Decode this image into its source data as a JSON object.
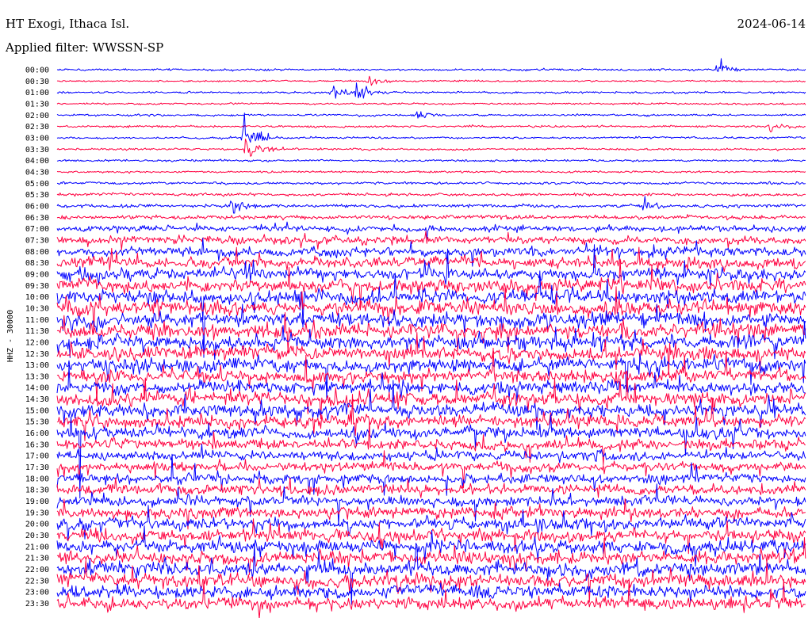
{
  "header": {
    "station": "HT Exogi, Ithaca Isl.",
    "date": "2024-06-14",
    "filter": "Applied filter: WWSSN-SP"
  },
  "chart_data": {
    "type": "line",
    "title": "HT Exogi, Ithaca Isl.",
    "date": "2024-06-14",
    "filter": "WWSSN-SP",
    "ylabel": "HHZ - 30000",
    "row_labels": [
      "00:00",
      "00:30",
      "01:00",
      "01:30",
      "02:00",
      "02:30",
      "03:00",
      "03:30",
      "04:00",
      "04:30",
      "05:00",
      "05:30",
      "06:00",
      "06:30",
      "07:00",
      "07:30",
      "08:00",
      "08:30",
      "09:00",
      "09:30",
      "10:00",
      "10:30",
      "11:00",
      "11:30",
      "12:00",
      "12:30",
      "13:00",
      "13:30",
      "14:00",
      "14:30",
      "15:00",
      "15:30",
      "16:00",
      "16:30",
      "17:00",
      "17:30",
      "18:00",
      "18:30",
      "19:00",
      "19:30",
      "20:00",
      "20:30",
      "21:00",
      "21:30",
      "22:00",
      "22:30",
      "23:00",
      "23:30"
    ],
    "row_minutes": 30,
    "trace_colors": [
      "#0000ff",
      "#ff0040"
    ],
    "relative_activity": [
      0.5,
      0.4,
      0.5,
      0.45,
      0.5,
      0.5,
      0.5,
      0.5,
      0.5,
      0.5,
      0.6,
      0.7,
      0.8,
      1.0,
      1.4,
      1.8,
      2.2,
      2.6,
      2.8,
      3.0,
      3.2,
      3.4,
      3.4,
      3.4,
      3.3,
      3.2,
      3.2,
      3.1,
      3.0,
      3.0,
      2.9,
      2.8,
      2.7,
      2.5,
      2.3,
      2.2,
      2.2,
      2.3,
      2.4,
      2.6,
      2.8,
      2.9,
      3.0,
      3.0,
      3.0,
      3.0,
      3.0,
      3.0
    ],
    "events": [
      {
        "row": "00:00",
        "minute": 26.5,
        "amplitude": 9
      },
      {
        "row": "00:30",
        "minute": 12.5,
        "amplitude": 6
      },
      {
        "row": "01:00",
        "minute": 11.0,
        "amplitude": 12
      },
      {
        "row": "01:00",
        "minute": 12.0,
        "amplitude": 8
      },
      {
        "row": "02:00",
        "minute": 14.5,
        "amplitude": 5
      },
      {
        "row": "02:30",
        "minute": 28.5,
        "amplitude": 6
      },
      {
        "row": "03:00",
        "minute": 7.5,
        "amplitude": 24
      },
      {
        "row": "03:30",
        "minute": 7.6,
        "amplitude": 18
      },
      {
        "row": "06:00",
        "minute": 7.0,
        "amplitude": 8
      },
      {
        "row": "06:00",
        "minute": 23.5,
        "amplitude": 7
      }
    ]
  }
}
